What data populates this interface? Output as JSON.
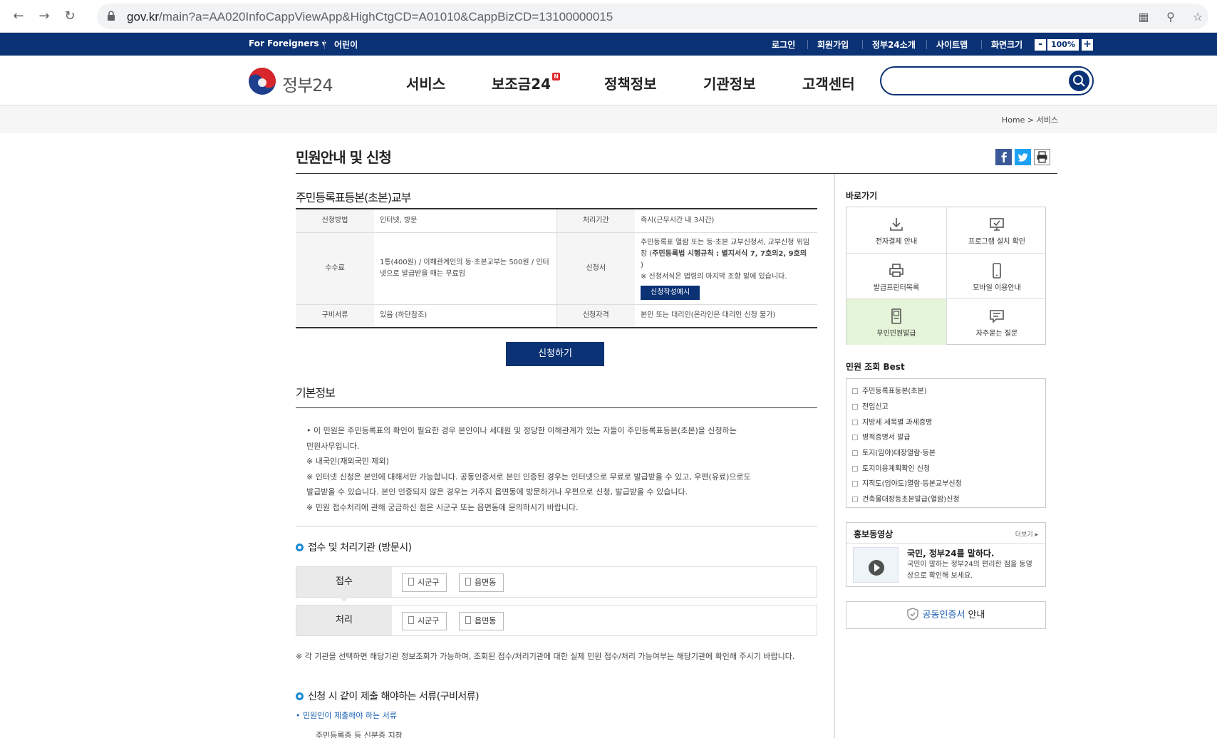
{
  "browser": {
    "url_domain": "gov.kr",
    "url_path": "/main?a=AA020InfoCappViewApp&HighCtgCD=A01010&CappBizCD=13100000015"
  },
  "topbar": {
    "foreigners": "For Foreigners",
    "kids": "어린이",
    "login": "로그인",
    "join": "회원가입",
    "about": "정부24소개",
    "sitemap": "사이트맵",
    "screen_size": "화면크기",
    "zoom_out": "-",
    "zoom_value": "100%",
    "zoom_in": "+"
  },
  "header": {
    "logo_text": "정부24",
    "nav": [
      "서비스",
      "보조금24",
      "정책정보",
      "기관정보",
      "고객센터"
    ],
    "new_badge": "N",
    "search_placeholder": ""
  },
  "breadcrumb": {
    "home": "Home",
    "sep": ">",
    "current": "서비스"
  },
  "page": {
    "title": "민원안내 및 신청",
    "service_name": "주민등록표등본(초본)교부"
  },
  "info_table": {
    "method_label": "신청방법",
    "method_value": "인터넷, 방문",
    "period_label": "처리기간",
    "period_value": "즉시(근무시간 내 3시간)",
    "fee_label": "수수료",
    "fee_value": "1통(400원) / 이해관계인의 등·초본교부는 500원 / 인터넷으로 발급받을 때는 무료임",
    "form_label": "신청서",
    "form_value_1": "주민등록표 열람 또는 등·초본 교부신청서, 교부신청 위임장 (",
    "form_value_bold": "주민등록법 시행규칙 : 별지서식 7, 7호의2, 9호의",
    "form_value_2": " )",
    "form_note": "※ 신청서식은 법령의 마지막 조항 밑에 있습니다.",
    "form_btn": "신청작성예시",
    "docs_label": "구비서류",
    "docs_value": "있음 (하단참조)",
    "qual_label": "신청자격",
    "qual_value": "본인 또는 대리인(온라인은 대리인 신청 불가)"
  },
  "apply_btn": "신청하기",
  "basic": {
    "title": "기본정보",
    "lines": [
      "• 이 민원은 주민등록표의 확인이 필요한 경우 본인이나 세대원 및 정당한 이해관계가 있는 자들이 주민등록표등본(초본)을 신청하는",
      "민원사무입니다.",
      "※ 내국인(재외국민 제외)",
      "※ 인터넷 신청은 본인에 대해서만 가능합니다. 공동인증서로 본인 인증된 경우는 인터넷으로 무료로 발급받을 수 있고, 우편(유료)으로도",
      "발급받을 수 있습니다. 본인 인증되지 않은 경우는 거주지 읍면동에 방문하거나 우편으로 신청, 발급받을 수 있습니다.",
      "※ 민원 접수처리에 관해 궁금하신 점은 시군구 또는 읍면동에 문의하시기 바랍니다."
    ]
  },
  "org": {
    "title": "접수 및 처리기관 (방문시)",
    "receive_label": "접수",
    "process_label": "처리",
    "btn_sigungu": "시군구",
    "btn_eupmyeon": "읍면동"
  },
  "org_note": "※ 각 기관을 선택하면 해당기관 정보조회가 가능하며, 조회된 접수/처리기관에 대한 실제 민원 접수/처리 가능여부는 해당기관에 확인해 주시기 바랍니다.",
  "docs": {
    "title": "신청 시 같이 제출 해야하는 서류(구비서류)",
    "link": "• 민원인이 제출해야 하는 서류",
    "item": "주민등록증 등 신분증 지참"
  },
  "sidebar": {
    "quick_title": "바로가기",
    "quick": [
      "전자결제 안내",
      "프로그램 설치 확인",
      "발급프린터목록",
      "모바일 이용안내",
      "무인민원발급",
      "자주묻는 질문"
    ],
    "best_title": "민원 조회 Best",
    "best": [
      "주민등록표등본(초본)",
      "전입신고",
      "지방세 세목별 과세증명",
      "병적증명서 발급",
      "토지(임야)대장열람·등본",
      "토지이용계획확인 신청",
      "지적도(임야도)열람·등본교부신청",
      "건축물대장등초본발급(열람)신청"
    ],
    "promo_title": "홍보동영상",
    "promo_more": "더보기",
    "promo_head": "국민, 정부24를 말하다.",
    "promo_desc": "국민이 말하는 정부24의 편리한 점을 동영상으로 확인해 보세요.",
    "cert_blue": "공동인증서",
    "cert_rest": " 안내"
  }
}
